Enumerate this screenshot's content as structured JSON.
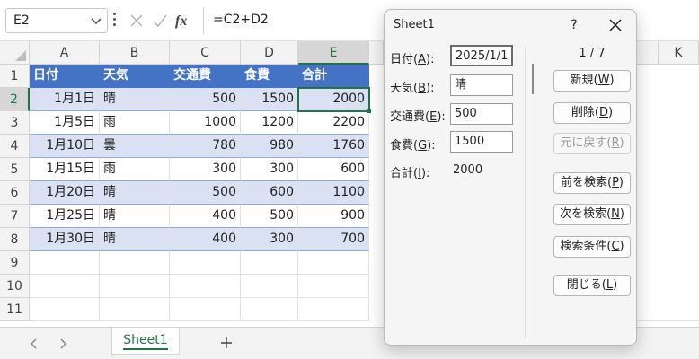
{
  "name_box": "E2",
  "formula": "=C2+D2",
  "columns": [
    "A",
    "B",
    "C",
    "D",
    "E",
    "K"
  ],
  "rows": [
    "1",
    "2",
    "3",
    "4",
    "5",
    "6",
    "7",
    "8",
    "9",
    "10",
    "11"
  ],
  "table": {
    "headers": [
      "日付",
      "天気",
      "交通費",
      "食費",
      "合計"
    ],
    "data": [
      [
        "1月1日",
        "晴",
        "500",
        "1500",
        "2000"
      ],
      [
        "1月5日",
        "雨",
        "1000",
        "1200",
        "2200"
      ],
      [
        "1月10日",
        "曇",
        "780",
        "980",
        "1760"
      ],
      [
        "1月15日",
        "雨",
        "300",
        "300",
        "600"
      ],
      [
        "1月20日",
        "晴",
        "500",
        "600",
        "1100"
      ],
      [
        "1月25日",
        "晴",
        "400",
        "500",
        "900"
      ],
      [
        "1月30日",
        "晴",
        "400",
        "300",
        "700"
      ]
    ]
  },
  "sheet_tab": "Sheet1",
  "dialog": {
    "title": "Sheet1",
    "help": "?",
    "counter": "1 / 7",
    "fields": [
      {
        "label": "日付",
        "key": "A",
        "value": "2025/1/1"
      },
      {
        "label": "天気",
        "key": "B",
        "value": "晴"
      },
      {
        "label": "交通費",
        "key": "E",
        "value": "500"
      },
      {
        "label": "食費",
        "key": "G",
        "value": "1500"
      }
    ],
    "total": {
      "label": "合計",
      "key": "I",
      "value": "2000"
    },
    "buttons": [
      {
        "label": "新規",
        "key": "W",
        "disabled": false
      },
      {
        "label": "削除",
        "key": "D",
        "disabled": false
      },
      {
        "label": "元に戻す",
        "key": "R",
        "disabled": true
      },
      {
        "label": "前を検索",
        "key": "P",
        "disabled": false
      },
      {
        "label": "次を検索",
        "key": "N",
        "disabled": false
      },
      {
        "label": "検索条件",
        "key": "C",
        "disabled": false
      },
      {
        "label": "閉じる",
        "key": "L",
        "disabled": false
      }
    ]
  },
  "colors": {
    "accent": "#217346",
    "table_header": "#4472c4",
    "table_band": "#d9e1f2"
  }
}
